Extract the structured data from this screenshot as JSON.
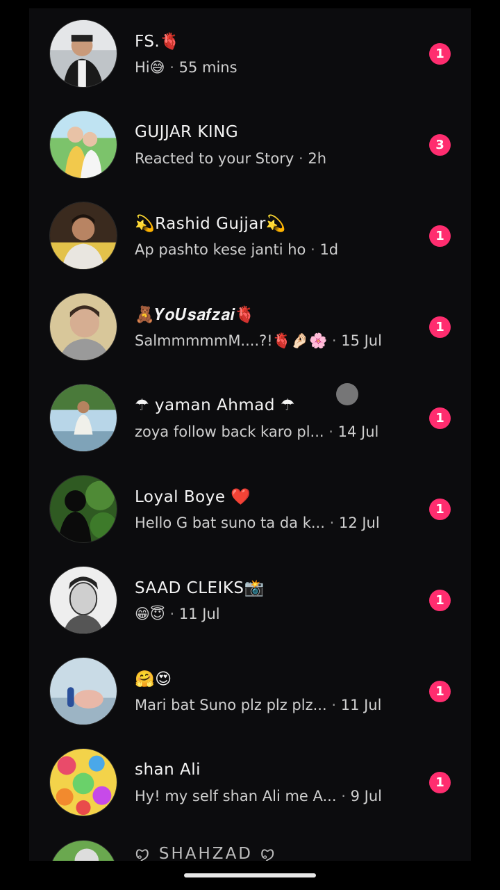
{
  "conversations": [
    {
      "name": "FS.🫀",
      "preview": "Hi😅",
      "time": "55 mins",
      "unread": "1"
    },
    {
      "name": "GUJJAR KING",
      "preview": "Reacted to your Story",
      "time": "2h",
      "unread": "3"
    },
    {
      "name": "💫Rashid Gujjar💫",
      "preview": "Ap pashto kese janti ho",
      "time": "1d",
      "unread": "1"
    },
    {
      "name": "🧸𝒀𝒐𝑼𝒔𝒂𝒇𝒛𝒂𝒊🫀",
      "preview": "SalmmmmmM....?!🫀🤌🏻🌸",
      "time": "15 Jul",
      "unread": "1"
    },
    {
      "name": "☂ yaman Ahmad ☂",
      "preview": "zoya follow back karo pl...",
      "time": "14 Jul",
      "unread": "1"
    },
    {
      "name": "Loyal Boye ❤️",
      "preview": "Hello G bat suno ta da k...",
      "time": "12 Jul",
      "unread": "1"
    },
    {
      "name": "SAAD CLEIKS📸",
      "preview": "😁😇",
      "time": "11 Jul",
      "unread": "1"
    },
    {
      "name": "🤗😍",
      "preview": "Mari bat Suno plz plz plz...",
      "time": "11 Jul",
      "unread": "1"
    },
    {
      "name": "shan Ali",
      "preview": "Hy! my self shan Ali me A...",
      "time": "9 Jul",
      "unread": "1"
    }
  ],
  "partial": {
    "name": "ꨄ SHAHZAD ꨄ"
  },
  "separator": "·",
  "colors": {
    "background": "#000000",
    "list_background": "#0c0c0e",
    "badge": "#ff2d6f",
    "name_text": "#f4f4f4",
    "preview_text": "#cfcfcf"
  }
}
